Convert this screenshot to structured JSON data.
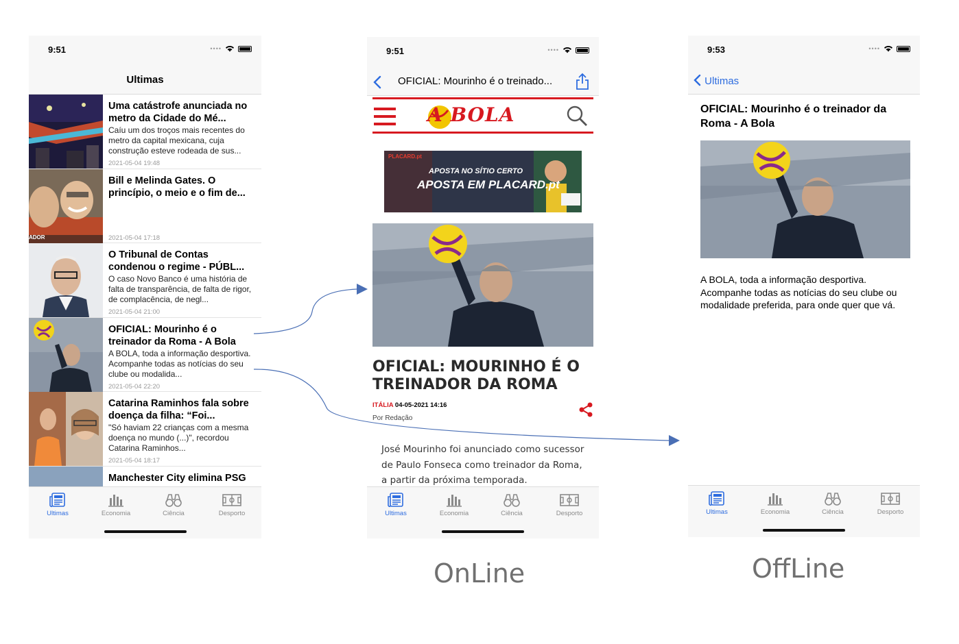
{
  "phone_list": {
    "time": "9:51",
    "title": "Ultimas",
    "items": [
      {
        "title": "Uma catástrofe anunciada no metro da Cidade do Mé...",
        "desc": "Caíu um dos troços mais recentes do metro da capital mexicana, cuja construção esteve rodeada de sus...",
        "date": "2021-05-04 19:48"
      },
      {
        "title": "Bill e Melinda Gates. O princípio, o meio e o fim de...",
        "desc": "",
        "date": "2021-05-04 17:18",
        "thumb_label": "ADOR"
      },
      {
        "title": "O Tribunal de Contas condenou o regime - PÚBL...",
        "desc": "O caso Novo Banco é uma história de falta de transparência, de falta de rigor, de complacência, de negl...",
        "date": "2021-05-04 21:00"
      },
      {
        "title": "OFICIAL: Mourinho é o treinador da Roma - A Bola",
        "desc": "A BOLA, toda a informação desportiva. Acompanhe todas as notícias do seu clube ou modalida...",
        "date": "2021-05-04 22:20"
      },
      {
        "title": "Catarina Raminhos fala sobre doença da filha: “Foi...",
        "desc": "\"Só haviam 22 crianças com a mesma doença no mundo (...)\", recordou Catarina Raminhos...",
        "date": "2021-05-04 18:17"
      },
      {
        "title": "Manchester City elimina PSG",
        "desc": "",
        "date": ""
      }
    ]
  },
  "tabs": [
    "Ultimas",
    "Economia",
    "Ciência",
    "Desporto"
  ],
  "phone_online": {
    "time": "9:51",
    "title": "OFICIAL: Mourinho é o treinado...",
    "logo": "A BOLA",
    "banner": {
      "brand": "PLACARD.pt",
      "line1": "APOSTA NO SÍTIO CERTO",
      "line2": "APOSTA EM PLACARD.pt"
    },
    "headline": "OFICIAL: MOURINHO É O TREINADOR DA ROMA",
    "category": "ITÁLIA",
    "datetime": "04-05-2021 14:16",
    "byline": "Por Redação",
    "body": "José Mourinho foi anunciado como sucessor de Paulo Fonseca como treinador da Roma, a partir da próxima temporada."
  },
  "phone_offline": {
    "time": "9:53",
    "back_label": "Ultimas",
    "title": "OFICIAL: Mourinho é o treinador da Roma - A Bola",
    "desc": "A BOLA, toda a informação desportiva. Acompanhe todas as notícias do seu clube ou modalidade preferida, para onde quer que vá."
  },
  "captions": {
    "online": "OnLine",
    "offline": "OffLine"
  },
  "colors": {
    "accent": "#2d6cdf",
    "abola_red": "#d71920",
    "arrow": "#4a6fb5"
  }
}
